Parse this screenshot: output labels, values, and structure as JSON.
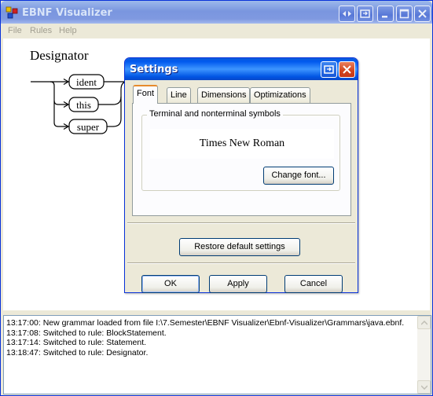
{
  "window": {
    "title": "EBNF Visualizer",
    "menu": [
      "File",
      "Rules",
      "Help"
    ]
  },
  "diagram": {
    "rule_name": "Designator",
    "alternatives": [
      "ident",
      "this",
      "super"
    ]
  },
  "log": {
    "lines": [
      "13:17:00: New grammar loaded from file I:\\7.Semester\\EBNF Visualizer\\Ebnf-Visualizer\\Grammars\\java.ebnf.",
      "13:17:08: Switched to rule: BlockStatement.",
      "13:17:14: Switched to rule: Statement.",
      "13:18:47: Switched to rule: Designator."
    ]
  },
  "settings": {
    "title": "Settings",
    "tabs": [
      "Font",
      "Line",
      "Dimensions",
      "Optimizations"
    ],
    "active_tab": "Font",
    "group_label": "Terminal and nonterminal symbols",
    "font_preview": "Times New Roman",
    "change_font_label": "Change font...",
    "restore_label": "Restore default settings",
    "ok_label": "OK",
    "apply_label": "Apply",
    "cancel_label": "Cancel"
  },
  "colors": {
    "dialog_titlebar": "#0058ee",
    "close_button": "#e04a1f",
    "active_tab_accent": "#e68b2c"
  }
}
